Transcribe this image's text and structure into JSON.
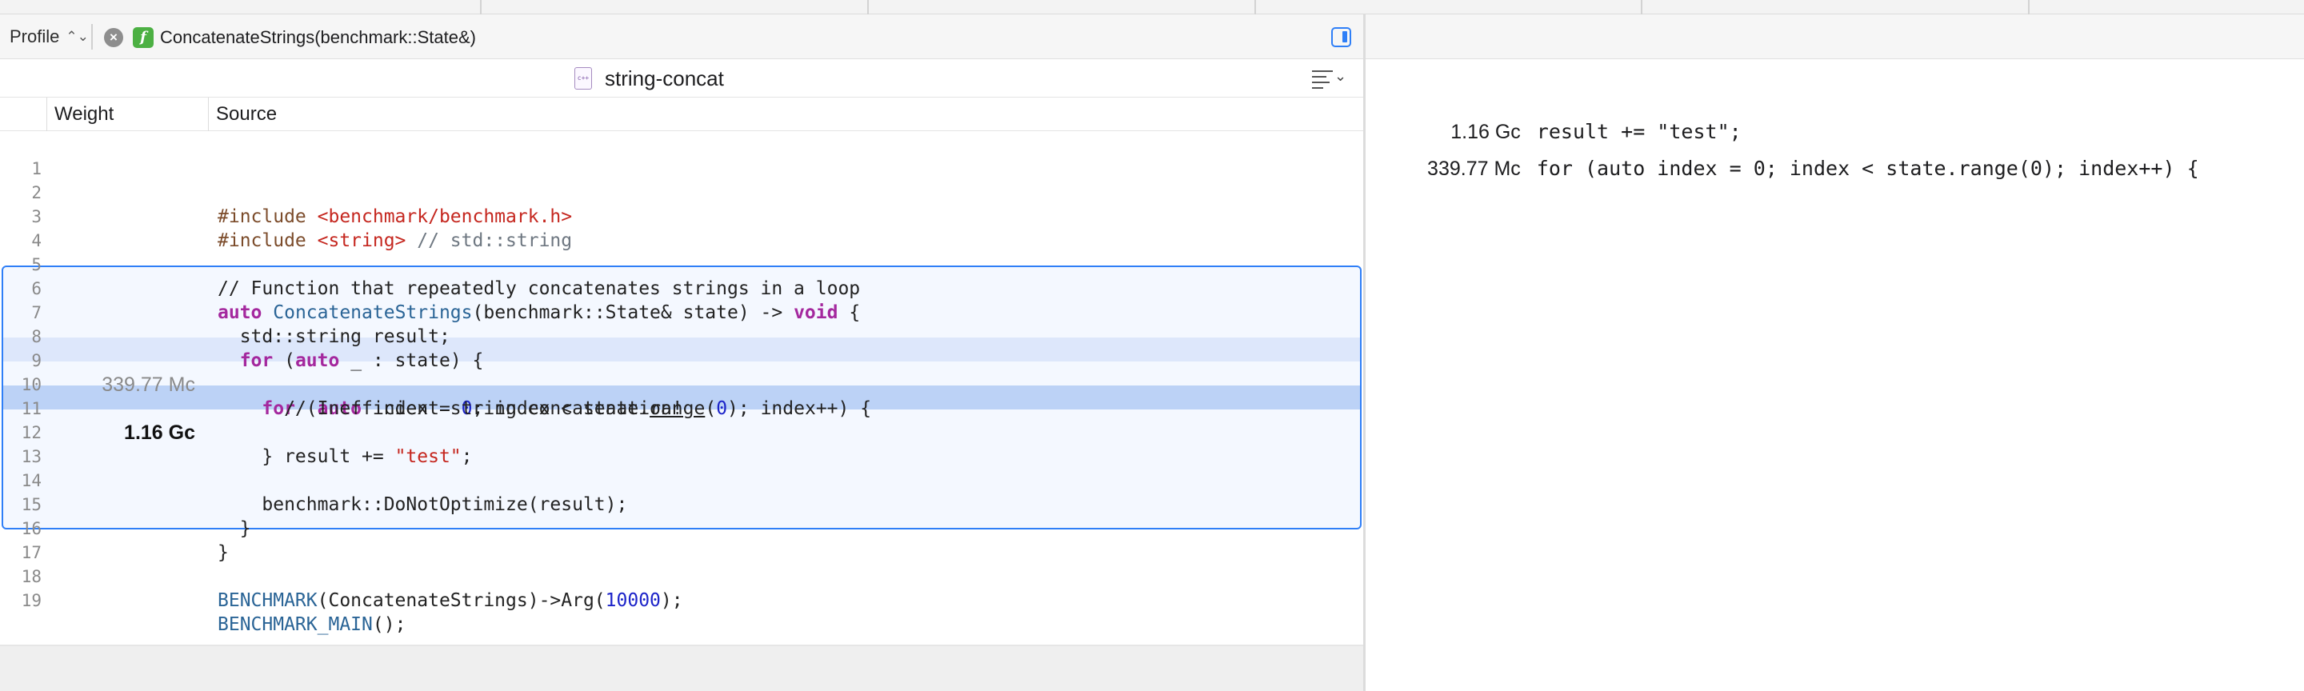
{
  "toolbar": {
    "profile_label": "Profile",
    "breadcrumb_function": "ConcatenateStrings(benchmark::State&)"
  },
  "file": {
    "name": "string-concat",
    "icon": "cpp-file-icon"
  },
  "columns": {
    "weight": "Weight",
    "source": "Source"
  },
  "lines": [
    {
      "num": "1",
      "weight": "",
      "code": "#include <benchmark/benchmark.h>"
    },
    {
      "num": "2",
      "weight": "",
      "code": ""
    },
    {
      "num": "3",
      "weight": "",
      "code": "#include <string> // std::string"
    },
    {
      "num": "4",
      "weight": "",
      "code": ""
    },
    {
      "num": "5",
      "weight": "",
      "code": "// Function that repeatedly concatenates strings in a loop"
    },
    {
      "num": "6",
      "weight": "",
      "code": "auto ConcatenateStrings(benchmark::State& state) -> void {"
    },
    {
      "num": "7",
      "weight": "",
      "code": "  std::string result;"
    },
    {
      "num": "8",
      "weight": "",
      "code": "  for (auto _ : state) {"
    },
    {
      "num": "9",
      "weight": "339.77 Mc",
      "code": "    for (auto index = 0; index < state.range(0); index++) {"
    },
    {
      "num": "10",
      "weight": "",
      "code": "      // Inefficient string concatenation!"
    },
    {
      "num": "11",
      "weight": "1.16 Gc",
      "code": "      result += \"test\";"
    },
    {
      "num": "12",
      "weight": "",
      "code": "    }"
    },
    {
      "num": "13",
      "weight": "",
      "code": ""
    },
    {
      "num": "14",
      "weight": "",
      "code": "    benchmark::DoNotOptimize(result);"
    },
    {
      "num": "15",
      "weight": "",
      "code": "  }"
    },
    {
      "num": "16",
      "weight": "",
      "code": "}"
    },
    {
      "num": "17",
      "weight": "",
      "code": ""
    },
    {
      "num": "18",
      "weight": "",
      "code": "BENCHMARK(ConcatenateStrings)->Arg(10000);"
    },
    {
      "num": "19",
      "weight": "",
      "code": "BENCHMARK_MAIN();"
    }
  ],
  "hot_lines": [
    {
      "weight": "1.16 Gc",
      "code": "result += \"test\";"
    },
    {
      "weight": "339.77 Mc",
      "code": "for (auto index = 0; index < state.range(0); index++) {"
    }
  ],
  "colors": {
    "accent": "#2f7ff7",
    "hot_row": "#bcd2f6",
    "warm_row": "#dde7fb",
    "keyword": "#a4289e",
    "string": "#c5271f",
    "number": "#1c23c9"
  }
}
